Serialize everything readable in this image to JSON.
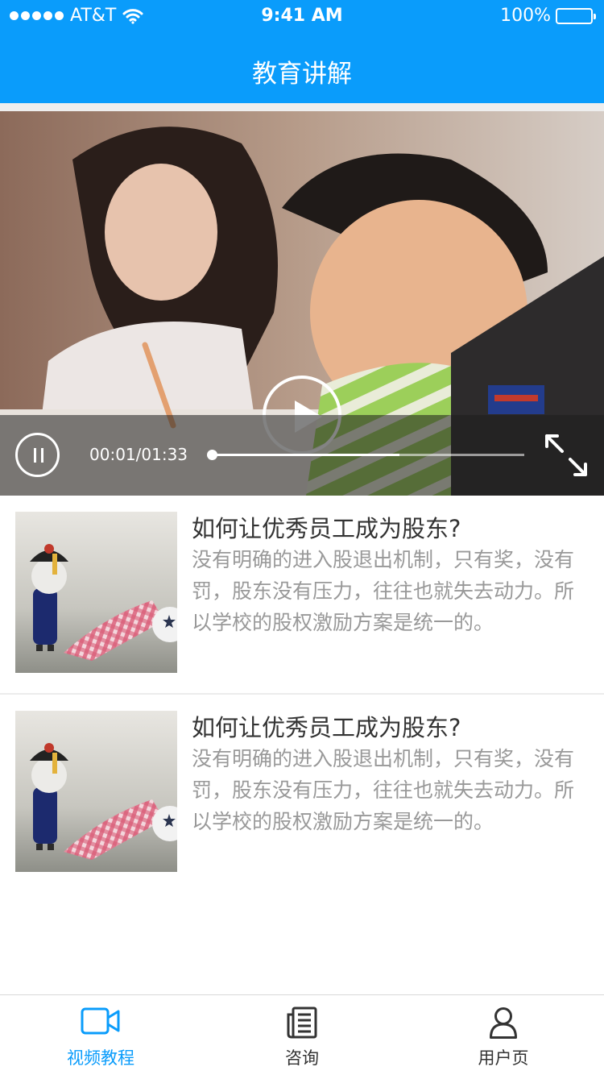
{
  "status_bar": {
    "carrier": "AT&T",
    "time": "9:41 AM",
    "battery": "100%"
  },
  "nav": {
    "title": "教育讲解"
  },
  "video": {
    "current_time": "00:01",
    "duration": "01:33",
    "time_display": "00:01/01:33",
    "buffered_fraction": 0.6,
    "played_fraction": 0.0
  },
  "articles": [
    {
      "title": "如何让优秀员工成为股东?",
      "description": "没有明确的进入股退出机制，只有奖，没有罚，股东没有压力，往往也就失去动力。所以学校的股权激励方案是统一的。"
    },
    {
      "title": "如何让优秀员工成为股东?",
      "description": "没有明确的进入股退出机制，只有奖，没有罚，股东没有压力，往往也就失去动力。所以学校的股权激励方案是统一的。"
    }
  ],
  "tabbar": {
    "tabs": [
      {
        "label": "视频教程",
        "icon": "video-camera-icon",
        "active": true
      },
      {
        "label": "咨询",
        "icon": "news-icon",
        "active": false
      },
      {
        "label": "用户页",
        "icon": "user-icon",
        "active": false
      }
    ]
  },
  "colors": {
    "brand_blue": "#0a9cfb",
    "title_text": "#333333",
    "desc_text": "#999999"
  }
}
